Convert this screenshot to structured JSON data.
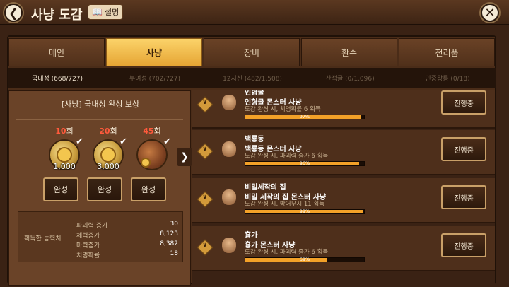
{
  "header": {
    "title": "사냥 도감",
    "help_label": "설명",
    "back_icon": "chevron-left-icon",
    "close_icon": "close-icon"
  },
  "tabs": [
    {
      "label": "메인",
      "active": false
    },
    {
      "label": "사냥",
      "active": true
    },
    {
      "label": "장비",
      "active": false
    },
    {
      "label": "환수",
      "active": false
    },
    {
      "label": "전리품",
      "active": false
    }
  ],
  "subtabs": [
    {
      "label": "국내성 (668/727)",
      "active": true
    },
    {
      "label": "부여성 (702/727)",
      "active": false
    },
    {
      "label": "12지신 (482/1,508)",
      "active": false
    },
    {
      "label": "산적굴 (0/1,096)",
      "active": false
    },
    {
      "label": "인중왕릉 (0/18)",
      "active": false
    }
  ],
  "left": {
    "title": "[사냥] 국내성 완성 보상",
    "rewards": [
      {
        "count": "10",
        "unit": "회",
        "value": "1,000",
        "complete_label": "완성"
      },
      {
        "count": "20",
        "unit": "회",
        "value": "3,000",
        "complete_label": "완성"
      },
      {
        "count": "45",
        "unit": "회",
        "value": "",
        "complete_label": "완성"
      }
    ],
    "stats_label": "획득한 능력치",
    "stats": [
      {
        "name": "파괴력 증가",
        "value": "30"
      },
      {
        "name": "체력증가",
        "value": "8,123"
      },
      {
        "name": "마력증가",
        "value": "8,382"
      },
      {
        "name": "치명확률",
        "value": "18"
      }
    ]
  },
  "cards": [
    {
      "header": "인형굴",
      "name": "인형굴 몬스터 사냥",
      "desc": "도감 완성 시, 치명확률 6 획득",
      "percent": 97,
      "percent_label": "97%",
      "button": "진행중"
    },
    {
      "header": "백룡동",
      "name": "백룡동 몬스터 사냥",
      "desc": "도감 완성 시, 파괴력 증가 6 획득",
      "percent": 96,
      "percent_label": "96%",
      "button": "진행중"
    },
    {
      "header": "비밀세작의 집",
      "name": "비밀 세작의 집 몬스터 사냥",
      "desc": "도감 완성 시, 방어무시 11 획득",
      "percent": 99,
      "percent_label": "99%",
      "button": "진행중"
    },
    {
      "header": "흉가",
      "name": "흉가 몬스터 사냥",
      "desc": "도감 완성 시, 파괴력 증가 6 획득",
      "percent": 69,
      "percent_label": "69%",
      "button": "진행중"
    }
  ]
}
